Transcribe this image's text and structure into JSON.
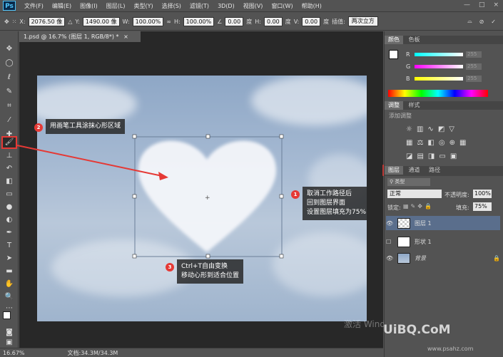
{
  "app": {
    "logo": "Ps"
  },
  "menu": [
    "文件(F)",
    "编辑(E)",
    "图像(I)",
    "图层(L)",
    "类型(Y)",
    "选择(S)",
    "滤镜(T)",
    "3D(D)",
    "视图(V)",
    "窗口(W)",
    "帮助(H)"
  ],
  "window_controls": {
    "minimize": "—",
    "maximize": "□",
    "close": "×"
  },
  "options": {
    "x_label": "X:",
    "x_value": "2076.50 像",
    "y_label": "Y:",
    "y_value": "1490.00 像",
    "w_label": "W:",
    "w_value": "100.00%",
    "h_label": "H:",
    "h_value": "100.00%",
    "angle_value": "0.00",
    "angle_unit": "度",
    "hskew_label": "H:",
    "hskew_value": "0.00",
    "hskew_unit": "度",
    "vskew_label": "V:",
    "vskew_value": "0.00",
    "vskew_unit": "度",
    "interp_label": "插值:",
    "interp_value": "两次立方"
  },
  "document": {
    "tab_title": "1.psd @ 16.7% (图层 1, RGB/8*) *",
    "tab_close": "×"
  },
  "status": {
    "zoom": "16.67%",
    "doc_info": "文档:34.3M/34.3M"
  },
  "panels": {
    "color_tabs": [
      "颜色",
      "色板"
    ],
    "color": {
      "r_label": "R",
      "g_label": "G",
      "b_label": "B",
      "r": "255",
      "g": "255",
      "b": "255"
    },
    "adjust_tabs": [
      "调整",
      "样式"
    ],
    "adjust_title": "添加调整",
    "layer_tabs": [
      "图层",
      "通道",
      "路径"
    ],
    "filter_kind": "类型",
    "blend_mode": "正常",
    "opacity_label": "不透明度:",
    "opacity_value": "100%",
    "lock_label": "锁定:",
    "fill_label": "填充:",
    "fill_value": "75%",
    "layers": [
      {
        "name": "图层 1",
        "selected": true,
        "visible": true
      },
      {
        "name": "形状 1",
        "selected": false,
        "visible": false
      },
      {
        "name": "背景",
        "selected": false,
        "visible": true
      }
    ]
  },
  "annotations": {
    "step1_num": "1",
    "step1_lines": [
      "取消工作路径后",
      "回到图层界面",
      "设置图层填充为75%"
    ],
    "step2_num": "2",
    "step2_text": "用画笔工具涂抹心形区域",
    "step3_num": "3",
    "step3_lines": [
      "Ctrl+T自由变换",
      "移动心形到适合位置"
    ]
  },
  "watermarks": {
    "activate": "激活 Windows",
    "site": "UiBQ.CoM",
    "site2": "www.psahz.com"
  },
  "colors": {
    "accent": "#e53935",
    "panel_bg": "#535353",
    "selected_layer": "#5a6e8c"
  }
}
